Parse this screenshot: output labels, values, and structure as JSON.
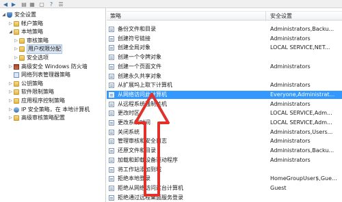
{
  "toolbar": {
    "buttons": [
      "back-arrow-icon",
      "forward-arrow-icon",
      "folder-up-icon",
      "grid-icon",
      "document-icon",
      "help-icon",
      "list-icon"
    ]
  },
  "tree": {
    "items": [
      {
        "label": "安全设置",
        "level": 0,
        "expander": "◢",
        "icon": "shield"
      },
      {
        "label": "帐户策略",
        "level": 1,
        "expander": "▷",
        "icon": "folder"
      },
      {
        "label": "本地策略",
        "level": 1,
        "expander": "◢",
        "icon": "folder"
      },
      {
        "label": "审核策略",
        "level": 2,
        "expander": "▷",
        "icon": "folder"
      },
      {
        "label": "用户权限分配",
        "level": 2,
        "expander": "▷",
        "icon": "folder",
        "selected": true
      },
      {
        "label": "安全选项",
        "level": 2,
        "expander": "▷",
        "icon": "folder"
      },
      {
        "label": "高级安全 Windows 防火墙",
        "level": 1,
        "expander": "▷",
        "icon": "fw"
      },
      {
        "label": "网络列表管理器策略",
        "level": 1,
        "expander": "",
        "icon": "policy"
      },
      {
        "label": "公钥策略",
        "level": 1,
        "expander": "▷",
        "icon": "folder"
      },
      {
        "label": "软件限制策略",
        "level": 1,
        "expander": "▷",
        "icon": "folder"
      },
      {
        "label": "应用程序控制策略",
        "level": 1,
        "expander": "▷",
        "icon": "folder"
      },
      {
        "label": "IP 安全策略，在 本地计算机",
        "level": 1,
        "expander": "▷",
        "icon": "ipsec"
      },
      {
        "label": "高级审核策略配置",
        "level": 1,
        "expander": "▷",
        "icon": "folder"
      }
    ]
  },
  "list": {
    "headers": {
      "policy": "策略",
      "setting": "安全设置"
    },
    "rows": [
      {
        "policy": "备份文件和目录",
        "setting": "Administrators,Backu..."
      },
      {
        "policy": "创建符号链接",
        "setting": "Administrators"
      },
      {
        "policy": "创建全局对象",
        "setting": "LOCAL SERVICE,NET..."
      },
      {
        "policy": "创建一个令牌对象",
        "setting": ""
      },
      {
        "policy": "创建一个页面文件",
        "setting": "Administrators"
      },
      {
        "policy": "创建永久共享对象",
        "setting": ""
      },
      {
        "policy": "从扩展坞上取下计算机",
        "setting": "Administrators"
      },
      {
        "policy": "从网络访问此计算机",
        "setting": "Everyone,Administrat...",
        "selected": true
      },
      {
        "policy": "从远程系统强制关机",
        "setting": "Administrators"
      },
      {
        "policy": "更改时区",
        "setting": "LOCAL SERVICE,Adm..."
      },
      {
        "policy": "更改系统时间",
        "setting": "LOCAL SERVICE,Adm..."
      },
      {
        "policy": "关闭系统",
        "setting": "Administrators,Users..."
      },
      {
        "policy": "管理审核和安全日志",
        "setting": "Administrators"
      },
      {
        "policy": "还原文件和目录",
        "setting": "Administrators,Backu..."
      },
      {
        "policy": "加载和卸载设备驱动程序",
        "setting": "Administrators"
      },
      {
        "policy": "将工作站添加到域",
        "setting": ""
      },
      {
        "policy": "拒绝本地登录",
        "setting": "HomeGroupUser$,Gue..."
      },
      {
        "policy": "拒绝从网络访问这台计算机",
        "setting": "Guest"
      },
      {
        "policy": "拒绝通过远程桌面服务登录",
        "setting": ""
      }
    ]
  },
  "colors": {
    "selection": "#3399ff",
    "arrow": "#e0322a"
  }
}
